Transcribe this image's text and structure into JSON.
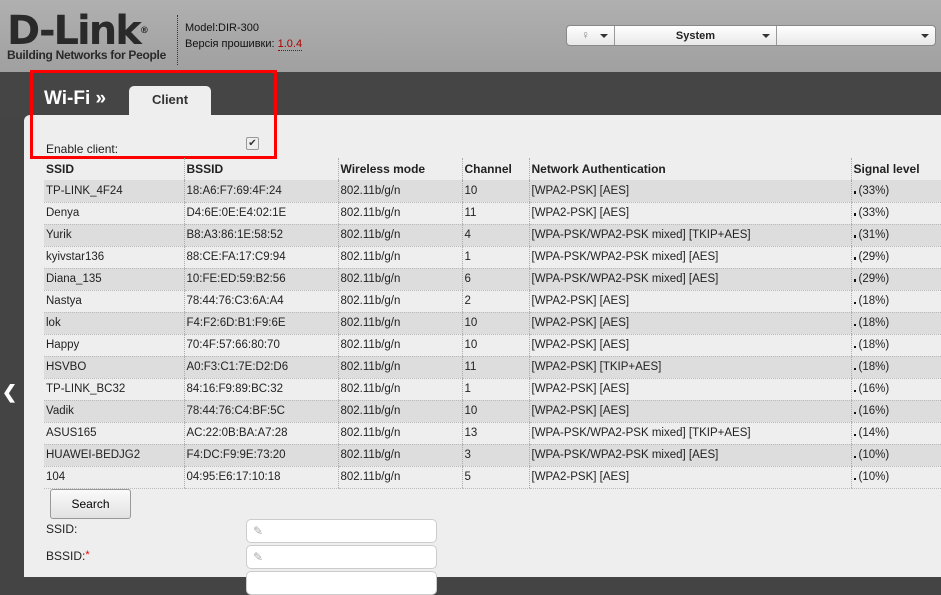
{
  "header": {
    "logo_text": "D-Link",
    "logo_tagline": "Building Networks for People",
    "model_label": "Model:",
    "model": "DIR-300",
    "firmware_label": "Версія прошивки:",
    "firmware": "1.0.4"
  },
  "topmenu": {
    "icon": "lightbulb-icon",
    "system_label": "System",
    "third_label": ""
  },
  "nav": {
    "section": "Wi-Fi »",
    "tab": "Client"
  },
  "form": {
    "enable_label": "Enable client:",
    "enable_checked": true,
    "search_label": "Search",
    "ssid_label": "SSID:",
    "bssid_label": "BSSID:",
    "required_mark": "*",
    "ssid_value": "",
    "bssid_value": ""
  },
  "table": {
    "headers": [
      "SSID",
      "BSSID",
      "Wireless mode",
      "Channel",
      "Network Authentication",
      "Signal level"
    ],
    "rows": [
      [
        "TP-LINK_4F24",
        "18:A6:F7:69:4F:24",
        "802.11b/g/n",
        "10",
        "[WPA2-PSK] [AES]",
        "(33%)"
      ],
      [
        "Denya",
        "D4:6E:0E:E4:02:1E",
        "802.11b/g/n",
        "11",
        "[WPA2-PSK] [AES]",
        "(33%)"
      ],
      [
        "Yurik",
        "B8:A3:86:1E:58:52",
        "802.11b/g/n",
        "4",
        "[WPA-PSK/WPA2-PSK mixed] [TKIP+AES]",
        "(31%)"
      ],
      [
        "kyivstar136",
        "88:CE:FA:17:C9:94",
        "802.11b/g/n",
        "1",
        "[WPA-PSK/WPA2-PSK mixed] [AES]",
        "(29%)"
      ],
      [
        "Diana_135",
        "10:FE:ED:59:B2:56",
        "802.11b/g/n",
        "6",
        "[WPA-PSK/WPA2-PSK mixed] [AES]",
        "(29%)"
      ],
      [
        "Nastya",
        "78:44:76:C3:6A:A4",
        "802.11b/g/n",
        "2",
        "[WPA2-PSK] [AES]",
        "(18%)"
      ],
      [
        "lok",
        "F4:F2:6D:B1:F9:6E",
        "802.11b/g/n",
        "10",
        "[WPA2-PSK] [AES]",
        "(18%)"
      ],
      [
        "Happy",
        "70:4F:57:66:80:70",
        "802.11b/g/n",
        "10",
        "[WPA2-PSK] [AES]",
        "(18%)"
      ],
      [
        "HSVBO",
        "A0:F3:C1:7E:D2:D6",
        "802.11b/g/n",
        "11",
        "[WPA2-PSK] [TKIP+AES]",
        "(18%)"
      ],
      [
        "TP-LINK_BC32",
        "84:16:F9:89:BC:32",
        "802.11b/g/n",
        "1",
        "[WPA2-PSK] [AES]",
        "(16%)"
      ],
      [
        "Vadik",
        "78:44:76:C4:BF:5C",
        "802.11b/g/n",
        "10",
        "[WPA2-PSK] [AES]",
        "(16%)"
      ],
      [
        "ASUS165",
        "AC:22:0B:BA:A7:28",
        "802.11b/g/n",
        "13",
        "[WPA-PSK/WPA2-PSK mixed] [TKIP+AES]",
        "(14%)"
      ],
      [
        "HUAWEI-BEDJG2",
        "F4:DC:F9:9E:73:20",
        "802.11b/g/n",
        "3",
        "[WPA-PSK/WPA2-PSK mixed] [AES]",
        "(10%)"
      ],
      [
        "104",
        "04:95:E6:17:10:18",
        "802.11b/g/n",
        "5",
        "[WPA2-PSK] [AES]",
        "(10%)"
      ]
    ]
  }
}
